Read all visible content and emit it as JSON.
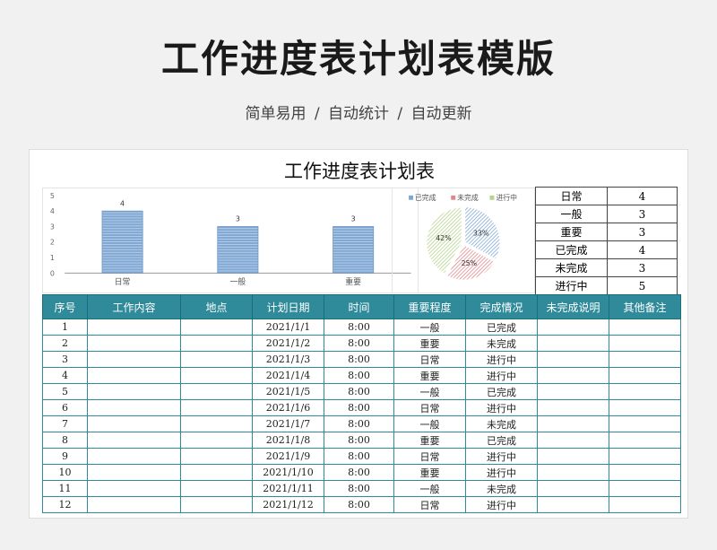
{
  "header": {
    "title": "工作进度表计划表模版",
    "subtitle": "简单易用   /   自动统计   /   自动更新"
  },
  "sheet": {
    "title": "工作进度表计划表"
  },
  "summary": [
    {
      "label": "日常",
      "value": "4"
    },
    {
      "label": "一般",
      "value": "3"
    },
    {
      "label": "重要",
      "value": "3"
    },
    {
      "label": "已完成",
      "value": "4"
    },
    {
      "label": "未完成",
      "value": "3"
    },
    {
      "label": "进行中",
      "value": "5"
    }
  ],
  "table": {
    "headers": [
      "序号",
      "工作内容",
      "地点",
      "计划日期",
      "时间",
      "重要程度",
      "完成情况",
      "未完成说明",
      "其他备注"
    ],
    "rows": [
      [
        "1",
        "",
        "",
        "2021/1/1",
        "8:00",
        "一般",
        "已完成",
        "",
        ""
      ],
      [
        "2",
        "",
        "",
        "2021/1/2",
        "8:00",
        "重要",
        "未完成",
        "",
        ""
      ],
      [
        "3",
        "",
        "",
        "2021/1/3",
        "8:00",
        "日常",
        "进行中",
        "",
        ""
      ],
      [
        "4",
        "",
        "",
        "2021/1/4",
        "8:00",
        "重要",
        "进行中",
        "",
        ""
      ],
      [
        "5",
        "",
        "",
        "2021/1/5",
        "8:00",
        "一般",
        "已完成",
        "",
        ""
      ],
      [
        "6",
        "",
        "",
        "2021/1/6",
        "8:00",
        "日常",
        "进行中",
        "",
        ""
      ],
      [
        "7",
        "",
        "",
        "2021/1/7",
        "8:00",
        "一般",
        "未完成",
        "",
        ""
      ],
      [
        "8",
        "",
        "",
        "2021/1/8",
        "8:00",
        "重要",
        "已完成",
        "",
        ""
      ],
      [
        "9",
        "",
        "",
        "2021/1/9",
        "8:00",
        "日常",
        "进行中",
        "",
        ""
      ],
      [
        "10",
        "",
        "",
        "2021/1/10",
        "8:00",
        "重要",
        "进行中",
        "",
        ""
      ],
      [
        "11",
        "",
        "",
        "2021/1/11",
        "8:00",
        "一般",
        "未完成",
        "",
        ""
      ],
      [
        "12",
        "",
        "",
        "2021/1/12",
        "8:00",
        "日常",
        "进行中",
        "",
        ""
      ]
    ]
  },
  "colors": {
    "bar": "#7fa7d3",
    "header_bg": "#2f8a9a",
    "pie_done": "#7fa7d3",
    "pie_undone": "#e0898c",
    "pie_progress": "#b5d38a"
  },
  "chart_data": [
    {
      "type": "bar",
      "categories": [
        "日常",
        "一般",
        "重要"
      ],
      "values": [
        4,
        3,
        3
      ],
      "ylim": [
        0,
        5
      ],
      "yticks": [
        "0",
        "1",
        "2",
        "3",
        "4",
        "5"
      ],
      "grid": false
    },
    {
      "type": "pie",
      "labels": [
        "已完成",
        "未完成",
        "进行中"
      ],
      "values": [
        33,
        25,
        42
      ],
      "value_labels": [
        "33%",
        "25%",
        "42%"
      ],
      "legend": "top"
    }
  ]
}
